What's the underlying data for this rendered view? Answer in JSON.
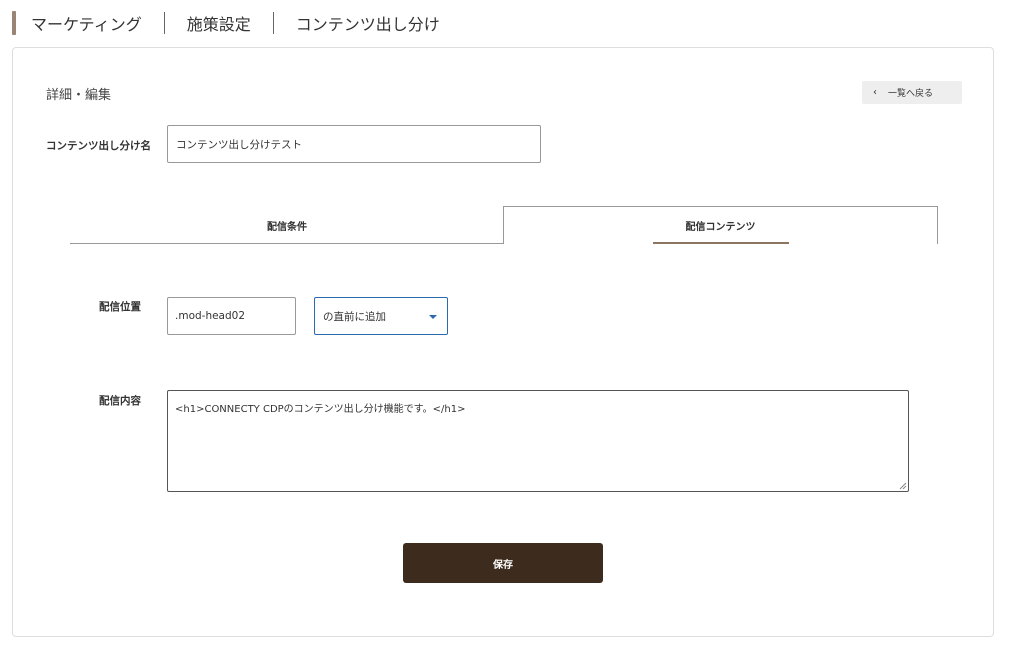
{
  "breadcrumb": {
    "items": [
      "マーケティング",
      "施策設定",
      "コンテンツ出し分け"
    ]
  },
  "section_title": "詳細・編集",
  "back_button": {
    "icon": "chevron-left-icon",
    "label": "一覧へ戻る"
  },
  "name_field": {
    "label": "コンテンツ出し分け名",
    "value": "コンテンツ出し分けテスト"
  },
  "tabs": [
    {
      "label": "配信条件",
      "active": false
    },
    {
      "label": "配信コンテンツ",
      "active": true
    }
  ],
  "position_field": {
    "label": "配信位置",
    "selector_value": ".mod-head02",
    "mode_selected": "の直前に追加"
  },
  "content_field": {
    "label": "配信内容",
    "value": "<h1>CONNECTY CDPのコンテンツ出し分け機能です。</h1>"
  },
  "save_button": {
    "label": "保存"
  },
  "colors": {
    "accent_brown": "#3d2c1e",
    "breadcrumb_bar": "#9a8574",
    "tab_underline": "#8a7560",
    "select_border": "#2a6bb0"
  }
}
